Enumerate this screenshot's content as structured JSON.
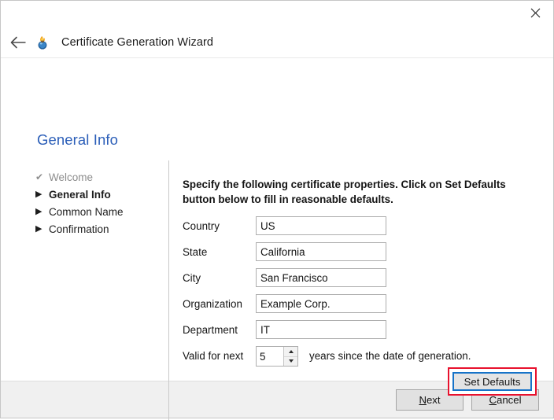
{
  "window": {
    "title": "Certificate Generation Wizard",
    "close_label": "✕",
    "back_label": "←",
    "app_icon": "torch-icon"
  },
  "page": {
    "heading": "General Info",
    "instruction": "Specify the following certificate properties. Click on Set Defaults button below to fill in reasonable defaults."
  },
  "nav": {
    "items": [
      {
        "label": "Welcome",
        "marker": "✔",
        "state": "done"
      },
      {
        "label": "General Info",
        "marker": "▶",
        "state": "current"
      },
      {
        "label": "Common Name",
        "marker": "▶",
        "state": "pending"
      },
      {
        "label": "Confirmation",
        "marker": "▶",
        "state": "pending"
      }
    ]
  },
  "form": {
    "fields": [
      {
        "label": "Country",
        "value": "US",
        "placeholder": ""
      },
      {
        "label": "State",
        "value": "California",
        "placeholder": ""
      },
      {
        "label": "City",
        "value": "San Francisco",
        "placeholder": ""
      },
      {
        "label": "Organization",
        "value": "Example Corp.",
        "placeholder": ""
      },
      {
        "label": "Department",
        "value": "IT",
        "placeholder": ""
      }
    ],
    "validity": {
      "label": "Valid for next",
      "value": "5",
      "suffix": "years since the date of generation."
    },
    "set_defaults_label": "Set Defaults"
  },
  "footer": {
    "next": {
      "pre": "",
      "accel": "N",
      "post": "ext"
    },
    "cancel": {
      "pre": "",
      "accel": "C",
      "post": "ancel"
    }
  },
  "colors": {
    "heading": "#2b5eb8",
    "highlight": "#e8112d",
    "focus": "#1673c8",
    "footer_bg": "#f0f0f0"
  }
}
